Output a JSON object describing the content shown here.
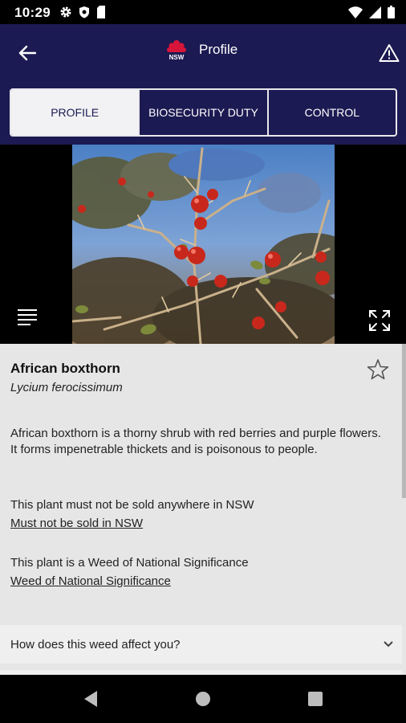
{
  "status_bar": {
    "time": "10:29",
    "left_icons": [
      "gear-icon",
      "shield-icon",
      "sim-card-icon"
    ],
    "right_icons": [
      "wifi-icon",
      "signal-icon",
      "battery-icon"
    ]
  },
  "app_bar": {
    "title": "Profile",
    "logo_text": "NSW",
    "back_icon": "arrow-left-icon",
    "warning_icon": "warning-icon"
  },
  "tabs": [
    {
      "label": "PROFILE",
      "active": true
    },
    {
      "label": "BIOSECURITY DUTY",
      "active": false
    },
    {
      "label": "CONTROL",
      "active": false
    }
  ],
  "weed": {
    "common_name": "African boxthorn",
    "scientific_name": "Lycium ferocissimum",
    "description": "African boxthorn is a thorny shrub with red berries and purple flowers. It forms impenetrable thickets and is poisonous to people.",
    "sale_rule": "This plant must not be sold anywhere in NSW",
    "sale_link": "Must not be sold in NSW",
    "wons_rule": "This plant is a Weed of National Significance",
    "wons_link": "Weed of National Significance"
  },
  "accordion": {
    "label": "How does this weed affect you?"
  },
  "colors": {
    "primary": "#1c1a52",
    "nsw_red": "#d7153a",
    "content_bg": "#e6e6e6"
  }
}
